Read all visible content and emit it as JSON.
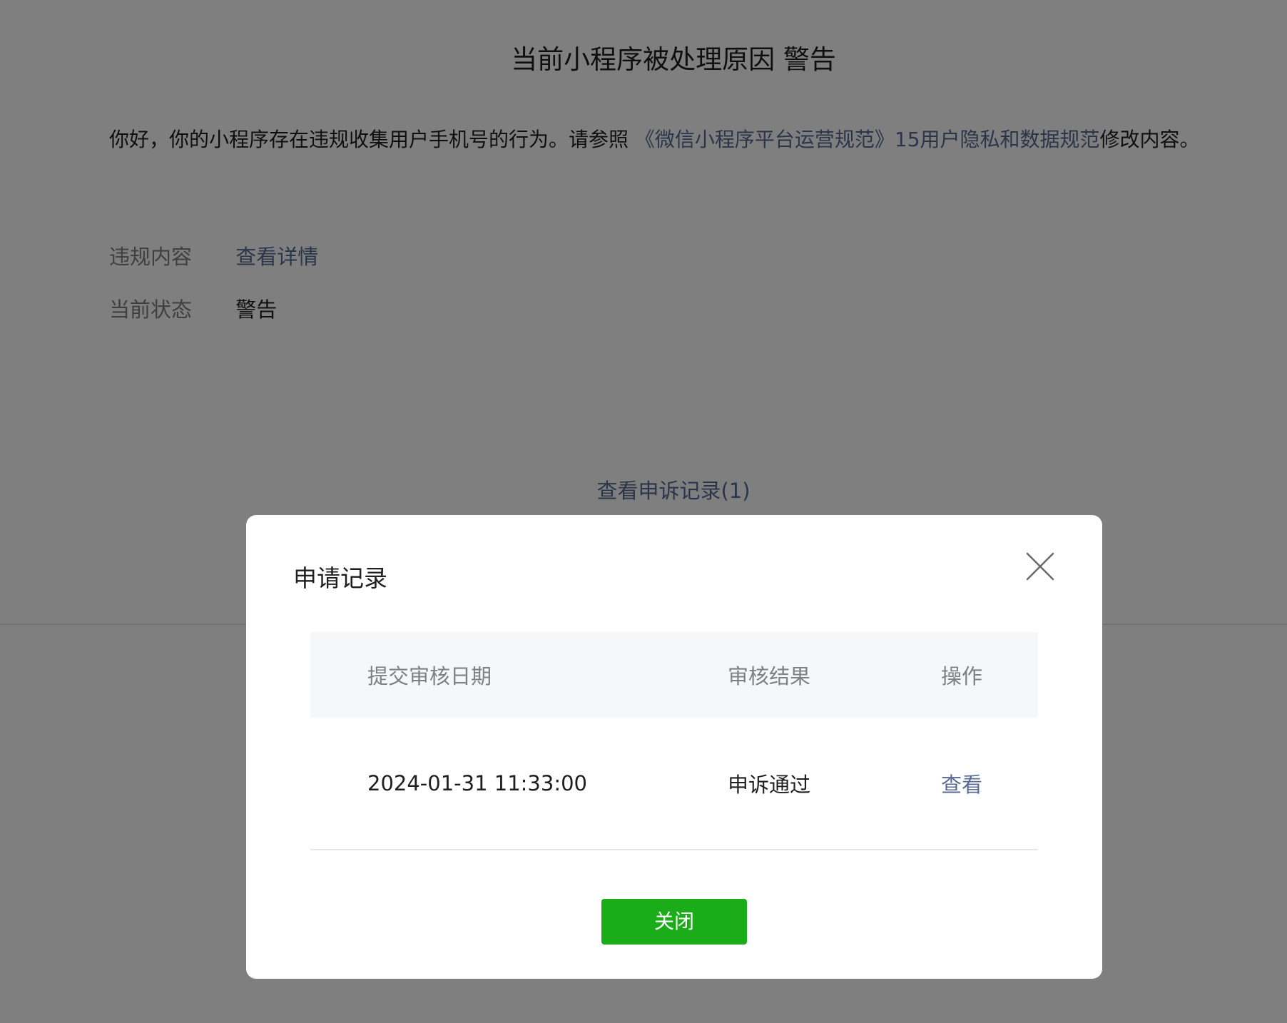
{
  "page": {
    "title": "当前小程序被处理原因 警告",
    "notice_prefix": "你好，你的小程序存在违规收集用户手机号的行为。请参照 ",
    "notice_link": "《微信小程序平台运营规范》15用户隐私和数据规范",
    "notice_suffix": "修改内容。",
    "info": {
      "violation_label": "违规内容",
      "violation_value": "查看详情",
      "status_label": "当前状态",
      "status_value": "警告"
    },
    "appeal_link": "查看申诉记录(1)"
  },
  "dialog": {
    "title": "申请记录",
    "close_icon": "close-icon",
    "table": {
      "headers": [
        "提交审核日期",
        "审核结果",
        "操作"
      ],
      "rows": [
        [
          "2024-01-31 11:33:00",
          "申诉通过",
          "查看"
        ]
      ]
    },
    "close_button": "关闭"
  },
  "colors": {
    "link": "#576b95",
    "primary_button": "#1aad19",
    "mask": "rgba(0,0,0,0.5)",
    "table_header_bg": "#f6f7f9"
  }
}
